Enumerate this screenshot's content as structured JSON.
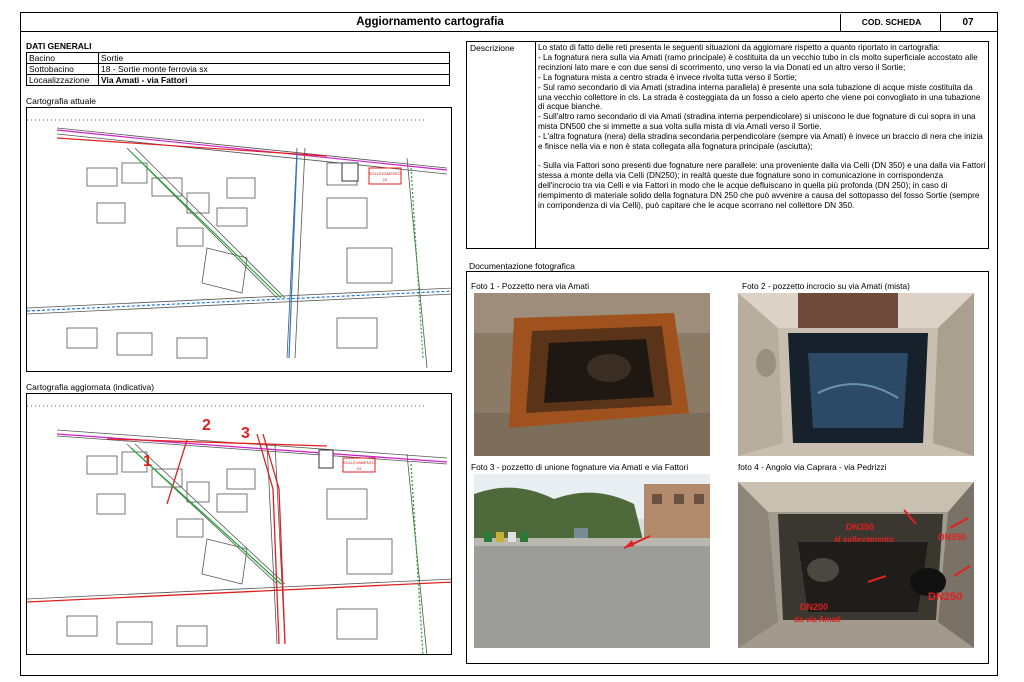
{
  "header": {
    "title": "Aggiornamento cartografia",
    "cod_label": "COD. SCHEDA",
    "cod_value": "07"
  },
  "dati_generali": {
    "heading": "DATI GENERALI",
    "rows": [
      {
        "label": "Bacino",
        "value": "Sortie"
      },
      {
        "label": "Sottobacino",
        "value": "18 - Sortie monte ferrovia sx"
      },
      {
        "label": "Locaalizzazione",
        "value": "Via Amati - via Fattori"
      }
    ]
  },
  "maps": {
    "current_label": "Cartografia attuale",
    "updated_label": "Cartografia aggiornata (indicativa)",
    "plant_label": "SOLLEVAMENTO",
    "plant_number": "24",
    "markers": [
      "1",
      "2",
      "3"
    ]
  },
  "description": {
    "label": "Descrizione",
    "paragraphs": [
      "Lo stato di fatto delle reti presenta le seguenti situazioni da aggiornare rispetto a quanto riportato in cartografia:",
      "- La fognatura nera sulla via Amati (ramo principale) è costituita da un vecchio tubo in cls molto superficiale accostato alle recinzioni lato mare e con due sensi di scorrimento, uno verso la via Donati ed un altro verso il Sortie;",
      "- La fognatura mista a centro strada è invece rivolta tutta verso il Sortie;",
      "- Sul ramo secondario di via Amati (stradina interna parallela) è presente una sola tubazione di acque miste costituita da una vecchio collettore in cls. La strada è costeggiata da un fosso a cielo aperto che viene poi convogliato in una tubazione di acque bianche.",
      "- Sull'altro ramo secondario di via Amati (stradina interna perpendicolare) si uniscono le due fognature di cui sopra in una mista DN500 che si  immette a sua volta sulla mista di via Amati verso il Sortie.",
      "- L'altra fognatura (nera) della stradina secondaria perpendicolare (sempre via Amati) è invece un braccio di nera che inizia e finisce nella via e non è stata collegata alla fognatura principale (asciutta);",
      "",
      " - Sulla via Fattori sono presenti due fognature nere parallele: una proveniente dalla via Celli (DN 350) e una dalla via Fattori stessa a monte della via Celli (DN250); in realtà queste due fognature sono in comunicazione in corrispondenza dell'incrocio tra via Celli e via Fattori in modo che le acque defluiscano in quella più profonda (DN 250); in caso di riempimento di materiale solido della fognatura DN 250 che può avvenire a causa del sottopasso del fosso Sortie (sempre in corripondenza di via Celli), può capitare che le acque scorrano nel collettore DN 350."
    ]
  },
  "photos": {
    "heading": "Documentazione fotografica",
    "items": [
      {
        "caption": "Foto 1 - Pozzetto nera via Amati"
      },
      {
        "caption": "Foto 2 - pozzetto incrocio su via Amati (mista)"
      },
      {
        "caption": "Foto 3 - pozzetto di unione fognature via Amati e via Fattori"
      },
      {
        "caption": "foto 4 - Angolo via Caprara - via Pedrizzi"
      }
    ],
    "annotations": {
      "dn350_sollevamento": "DN350",
      "sollevamento_sub": "al sollevamento",
      "dn350_right": "DN350",
      "dn250": "DN250",
      "dn200": "DN200",
      "dn200_sub": "da via Amati"
    }
  },
  "colors": {
    "road_red": "#e02020",
    "pipe_magenta": "#cc22cc",
    "pipe_blue": "#2277dd",
    "pipe_green": "#22aa33",
    "map_grey": "#555555"
  }
}
